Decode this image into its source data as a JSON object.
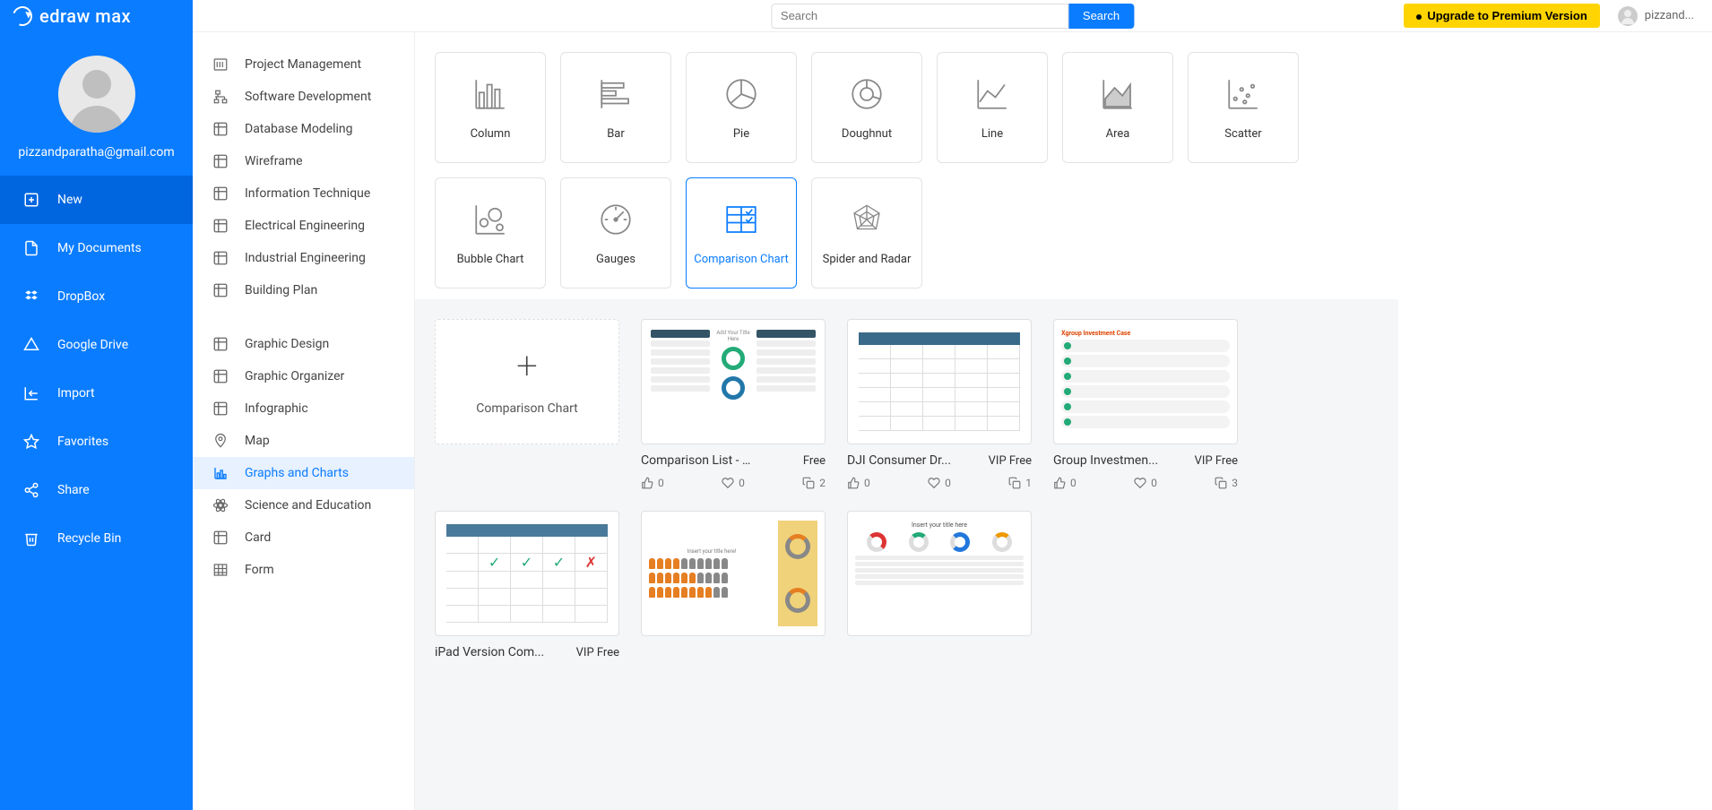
{
  "app": {
    "name": "edraw max"
  },
  "topbar": {
    "search_placeholder": "Search",
    "search_button": "Search",
    "upgrade": "Upgrade to Premium Version",
    "username": "pizzand..."
  },
  "profile": {
    "email": "pizzandparatha@gmail.com"
  },
  "nav": [
    {
      "id": "new",
      "label": "New",
      "active": true
    },
    {
      "id": "mydocs",
      "label": "My Documents"
    },
    {
      "id": "dropbox",
      "label": "DropBox"
    },
    {
      "id": "gdrive",
      "label": "Google Drive"
    },
    {
      "id": "import",
      "label": "Import"
    },
    {
      "id": "favorites",
      "label": "Favorites"
    },
    {
      "id": "share",
      "label": "Share"
    },
    {
      "id": "recycle",
      "label": "Recycle Bin"
    }
  ],
  "categories_top": [
    {
      "id": "pm",
      "label": "Project Management"
    },
    {
      "id": "sd",
      "label": "Software Development"
    },
    {
      "id": "dm",
      "label": "Database Modeling"
    },
    {
      "id": "wf",
      "label": "Wireframe"
    },
    {
      "id": "it",
      "label": "Information Technique"
    },
    {
      "id": "ee",
      "label": "Electrical Engineering"
    },
    {
      "id": "ie",
      "label": "Industrial Engineering"
    },
    {
      "id": "bp",
      "label": "Building Plan"
    }
  ],
  "categories_bottom": [
    {
      "id": "gd",
      "label": "Graphic Design"
    },
    {
      "id": "go",
      "label": "Graphic Organizer"
    },
    {
      "id": "info",
      "label": "Infographic"
    },
    {
      "id": "map",
      "label": "Map"
    },
    {
      "id": "charts",
      "label": "Graphs and Charts",
      "selected": true
    },
    {
      "id": "sci",
      "label": "Science and Education"
    },
    {
      "id": "card",
      "label": "Card"
    },
    {
      "id": "form",
      "label": "Form"
    }
  ],
  "chart_types": [
    {
      "id": "column",
      "label": "Column"
    },
    {
      "id": "bar",
      "label": "Bar"
    },
    {
      "id": "pie",
      "label": "Pie"
    },
    {
      "id": "doughnut",
      "label": "Doughnut"
    },
    {
      "id": "line",
      "label": "Line"
    },
    {
      "id": "area",
      "label": "Area"
    },
    {
      "id": "scatter",
      "label": "Scatter"
    },
    {
      "id": "bubble",
      "label": "Bubble Chart"
    },
    {
      "id": "gauges",
      "label": "Gauges"
    },
    {
      "id": "comparison",
      "label": "Comparison Chart",
      "selected": true
    },
    {
      "id": "radar",
      "label": "Spider and Radar"
    }
  ],
  "new_template_label": "Comparison Chart",
  "templates": [
    {
      "id": "t1",
      "title": "Comparison List - Pas...",
      "badge": "Free",
      "likes": 0,
      "favs": 0,
      "copies": 2
    },
    {
      "id": "t2",
      "title": "DJI Consumer Dr...",
      "badge": "VIP Free",
      "likes": 0,
      "favs": 0,
      "copies": 1
    },
    {
      "id": "t3",
      "title": "Group Investmen...",
      "badge": "VIP Free",
      "likes": 0,
      "favs": 0,
      "copies": 3
    },
    {
      "id": "t4",
      "title": "iPad Version Com...",
      "badge": "VIP Free"
    },
    {
      "id": "t5",
      "title": "",
      "badge": ""
    },
    {
      "id": "t6",
      "title": "",
      "badge": ""
    }
  ]
}
